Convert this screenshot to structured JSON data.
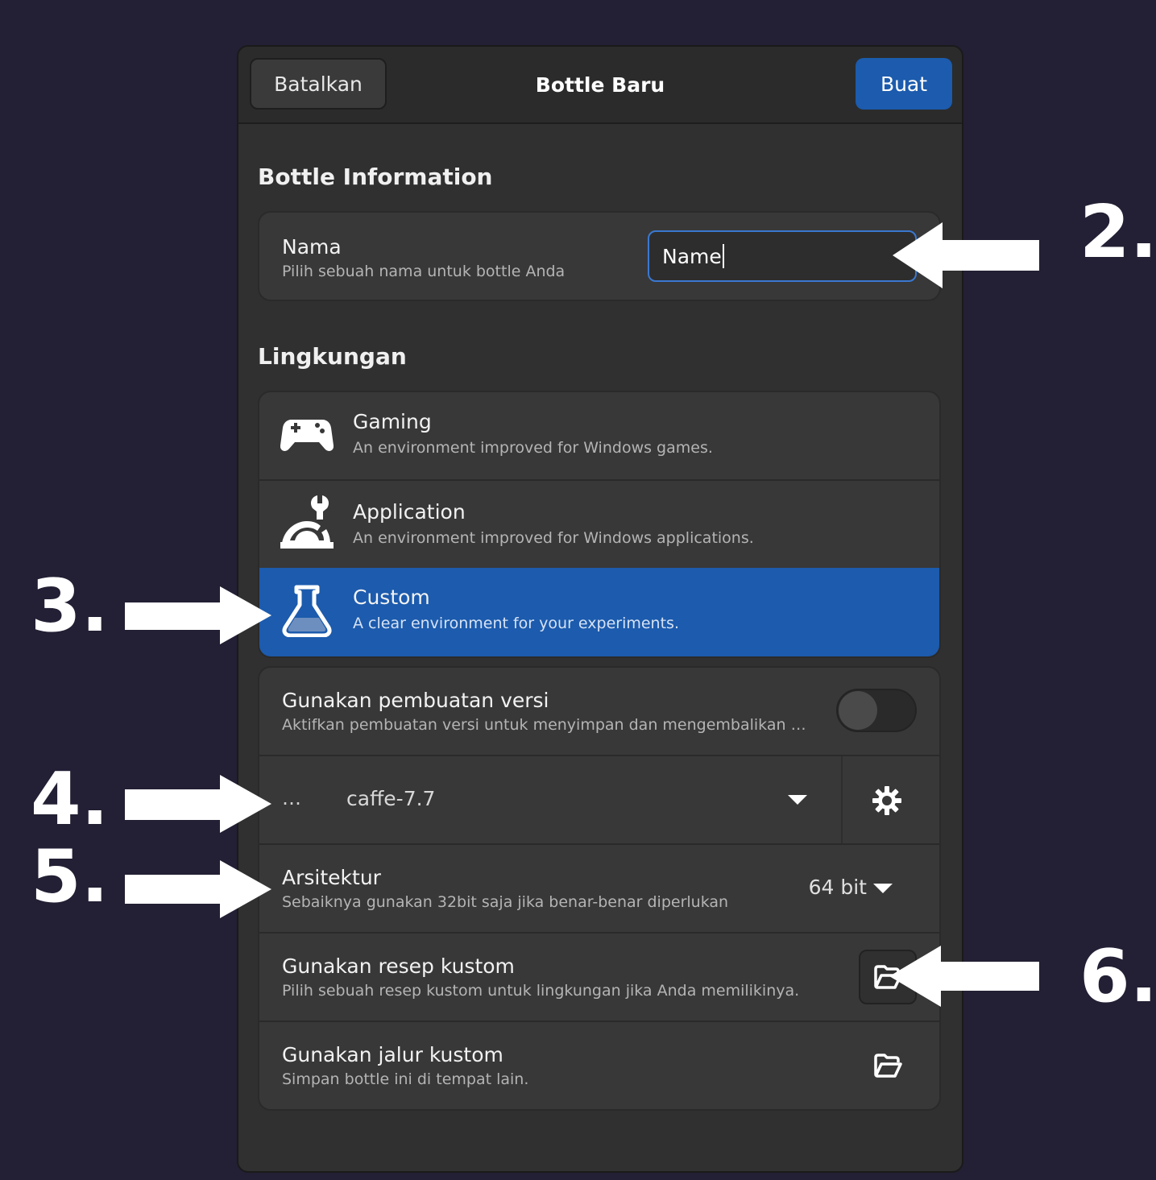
{
  "dialog": {
    "cancel_label": "Batalkan",
    "title": "Bottle Baru",
    "create_label": "Buat"
  },
  "bottle_info": {
    "section_title": "Bottle Information",
    "name_title": "Nama",
    "name_subtitle": "Pilih sebuah nama untuk bottle Anda",
    "name_value": "Name"
  },
  "environment": {
    "section_title": "Lingkungan",
    "options": [
      {
        "title": "Gaming",
        "subtitle": "An environment improved for Windows games.",
        "icon": "gamepad-icon"
      },
      {
        "title": "Application",
        "subtitle": "An environment improved for Windows applications.",
        "icon": "tools-icon"
      },
      {
        "title": "Custom",
        "subtitle": "A clear environment for your experiments.",
        "icon": "flask-icon",
        "selected": true
      }
    ]
  },
  "options": {
    "versioning_title": "Gunakan pembuatan versi",
    "versioning_subtitle": "Aktifkan pembuatan versi untuk menyimpan dan mengembalikan …",
    "versioning_enabled": false,
    "runner_ellipsis": "…",
    "runner_value": "caffe-7.7",
    "arch_title": "Arsitektur",
    "arch_subtitle": "Sebaiknya gunakan 32bit saja jika benar-benar diperlukan",
    "arch_value": "64 bit",
    "recipe_title": "Gunakan resep kustom",
    "recipe_subtitle": "Pilih sebuah resep kustom untuk lingkungan jika Anda memilikinya.",
    "path_title": "Gunakan jalur kustom",
    "path_subtitle": "Simpan bottle ini di tempat lain."
  },
  "annotations": {
    "label_2": "2.",
    "label_3": "3.",
    "label_4": "4.",
    "label_5": "5.",
    "label_6": "6."
  },
  "colors": {
    "background": "#231f34",
    "accent": "#1c5bad",
    "dialog": "#303030",
    "card": "#383838"
  }
}
